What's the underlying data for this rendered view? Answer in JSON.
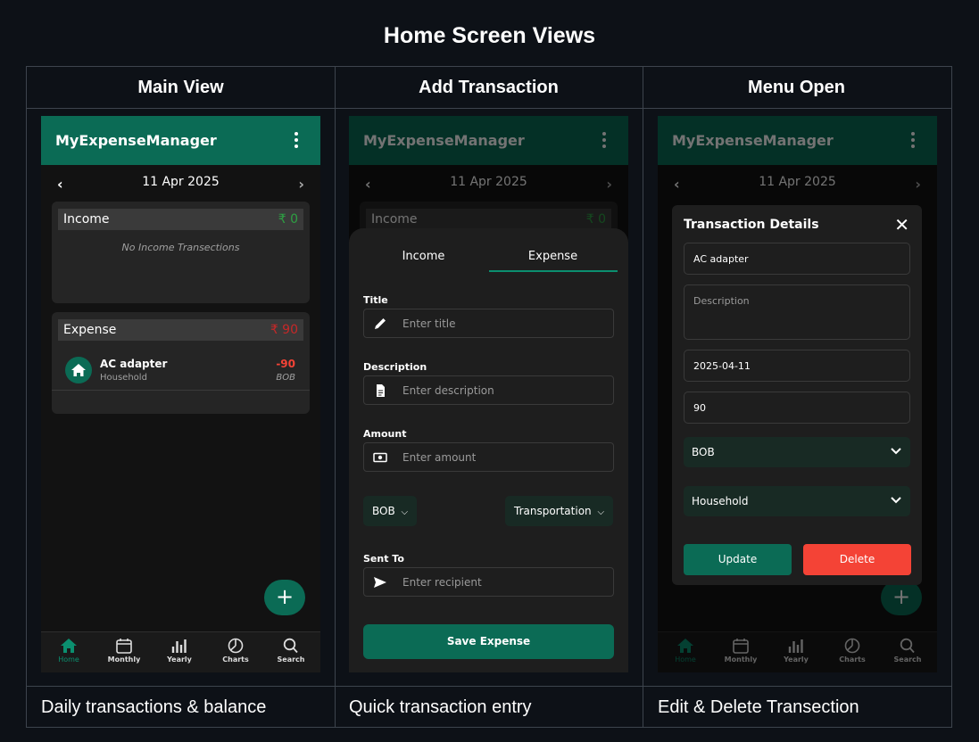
{
  "title": "Home Screen Views",
  "columns": [
    {
      "heading": "Main View",
      "caption": "Daily transactions & balance"
    },
    {
      "heading": "Add Transaction",
      "caption": "Quick transaction entry"
    },
    {
      "heading": "Menu Open",
      "caption": "Edit & Delete Transection"
    }
  ],
  "app": {
    "name": "MyExpenseManager",
    "date": "11 Apr 2025",
    "income_label": "Income",
    "income_amount": "₹ 0",
    "no_income": "No Income Transections",
    "expense_label": "Expense",
    "expense_amount": "₹ 90",
    "transaction": {
      "name": "AC adapter",
      "category": "Household",
      "amount": "-90",
      "account": "BOB"
    },
    "fab": "+",
    "nav": [
      "Home",
      "Monthly",
      "Yearly",
      "Charts",
      "Search"
    ]
  },
  "add_form": {
    "tabs": [
      "Income",
      "Expense"
    ],
    "active_tab": "Expense",
    "title_label": "Title",
    "title_placeholder": "Enter title",
    "description_label": "Description",
    "description_placeholder": "Enter description",
    "amount_label": "Amount",
    "amount_placeholder": "Enter amount",
    "account": "BOB",
    "category": "Transportation",
    "sent_to_label": "Sent To",
    "sent_to_placeholder": "Enter recipient",
    "save": "Save Expense"
  },
  "dialog": {
    "title": "Transaction Details",
    "close": "✕",
    "name": "AC adapter",
    "description_placeholder": "Description",
    "date": "2025-04-11",
    "amount": "90",
    "account": "BOB",
    "category": "Household",
    "update": "Update",
    "delete": "Delete"
  },
  "colors": {
    "accent": "#0b6b55",
    "income": "#2ea043",
    "expense": "#f44336",
    "background": "#0d1117"
  }
}
